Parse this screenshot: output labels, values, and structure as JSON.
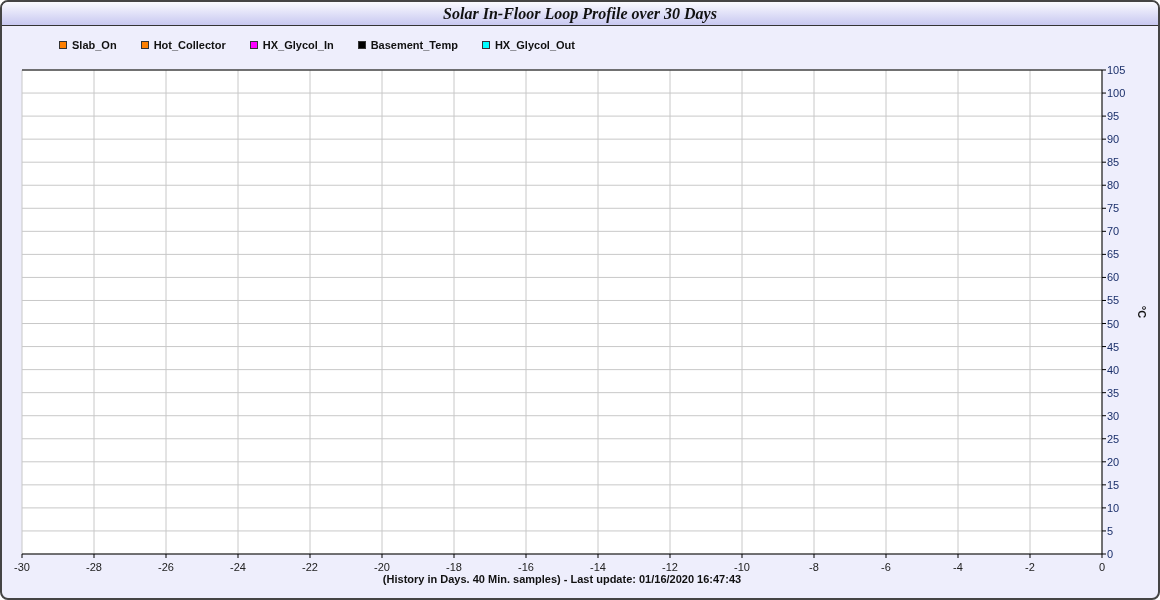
{
  "window": {
    "title": "Solar In-Floor Loop Profile over 30 Days"
  },
  "chart": {
    "chart_data": {
      "type": "line",
      "xlabel": "(History in Days. 40 Min. samples) - Last update: 01/16/2020 16:47:43",
      "ylabel": "°C",
      "grid": true,
      "ylim": [
        0,
        105
      ],
      "categories": [
        "-30",
        "-28",
        "-26",
        "-24",
        "-22",
        "-20",
        "-18",
        "-16",
        "-14",
        "-12",
        "-10",
        "-8",
        "-6",
        "-4",
        "-2",
        "0"
      ],
      "yticks": [
        0,
        5,
        10,
        15,
        20,
        25,
        30,
        35,
        40,
        45,
        50,
        55,
        60,
        65,
        70,
        75,
        80,
        85,
        90,
        95,
        100,
        105
      ],
      "series": [
        {
          "name": "Slab_On",
          "color": "#ff8000",
          "values": [
            null,
            null,
            null,
            null,
            null,
            null,
            null,
            null,
            null,
            null,
            null,
            null,
            null,
            null,
            null,
            null
          ]
        },
        {
          "name": "Hot_Collector",
          "color": "#ff8000",
          "values": [
            null,
            null,
            null,
            null,
            null,
            null,
            null,
            null,
            null,
            null,
            null,
            null,
            null,
            null,
            null,
            null
          ]
        },
        {
          "name": "HX_Glycol_In",
          "color": "#ff00ff",
          "values": [
            null,
            null,
            null,
            null,
            null,
            null,
            null,
            null,
            null,
            null,
            null,
            null,
            null,
            null,
            null,
            null
          ]
        },
        {
          "name": "Basement_Temp",
          "color": "#000000",
          "values": [
            null,
            null,
            null,
            null,
            null,
            null,
            null,
            null,
            null,
            null,
            null,
            null,
            null,
            null,
            null,
            null
          ]
        },
        {
          "name": "HX_Glycol_Out",
          "color": "#00ffff",
          "values": [
            null,
            null,
            null,
            null,
            null,
            null,
            null,
            null,
            null,
            null,
            null,
            null,
            null,
            null,
            null,
            null
          ]
        }
      ]
    }
  }
}
